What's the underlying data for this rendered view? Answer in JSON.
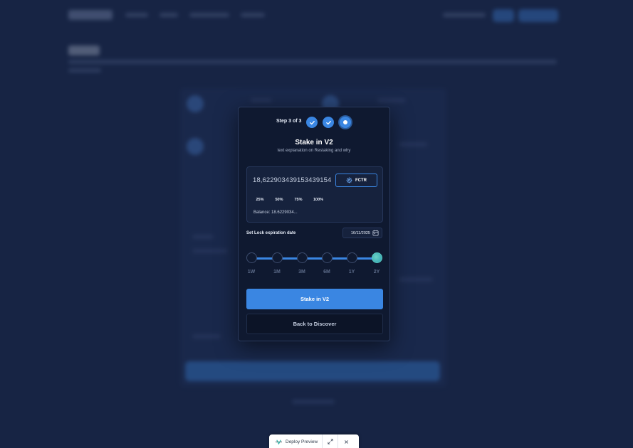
{
  "modal": {
    "step_text": "Step 3 of 3",
    "title": "Stake in V2",
    "subtitle": "text explanation on Restaking and why",
    "amount_value": "18,622903439153439154",
    "token_label": "FCTR",
    "percent_options": [
      "25%",
      "50%",
      "75%",
      "100%"
    ],
    "balance_text": "Balance: 18.6229034...",
    "lock_label": "Set Lock expiration date",
    "date_value": "16/11/2025",
    "durations": [
      "1W",
      "1M",
      "3M",
      "6M",
      "1Y",
      "2Y"
    ],
    "selected_duration": "2Y",
    "primary_button": "Stake in V2",
    "secondary_button": "Back to Discover"
  },
  "deploy_bar": {
    "label": "Deploy Preview"
  },
  "colors": {
    "accent": "#3a86e2",
    "background": "#1b2a4e",
    "modal": "#0f1930",
    "selected_node": "#3db8b0"
  },
  "icons": {
    "completed_step": "check-icon",
    "token": "gear-icon",
    "date": "calendar-icon",
    "expand": "expand-icon",
    "close": "close-icon"
  }
}
